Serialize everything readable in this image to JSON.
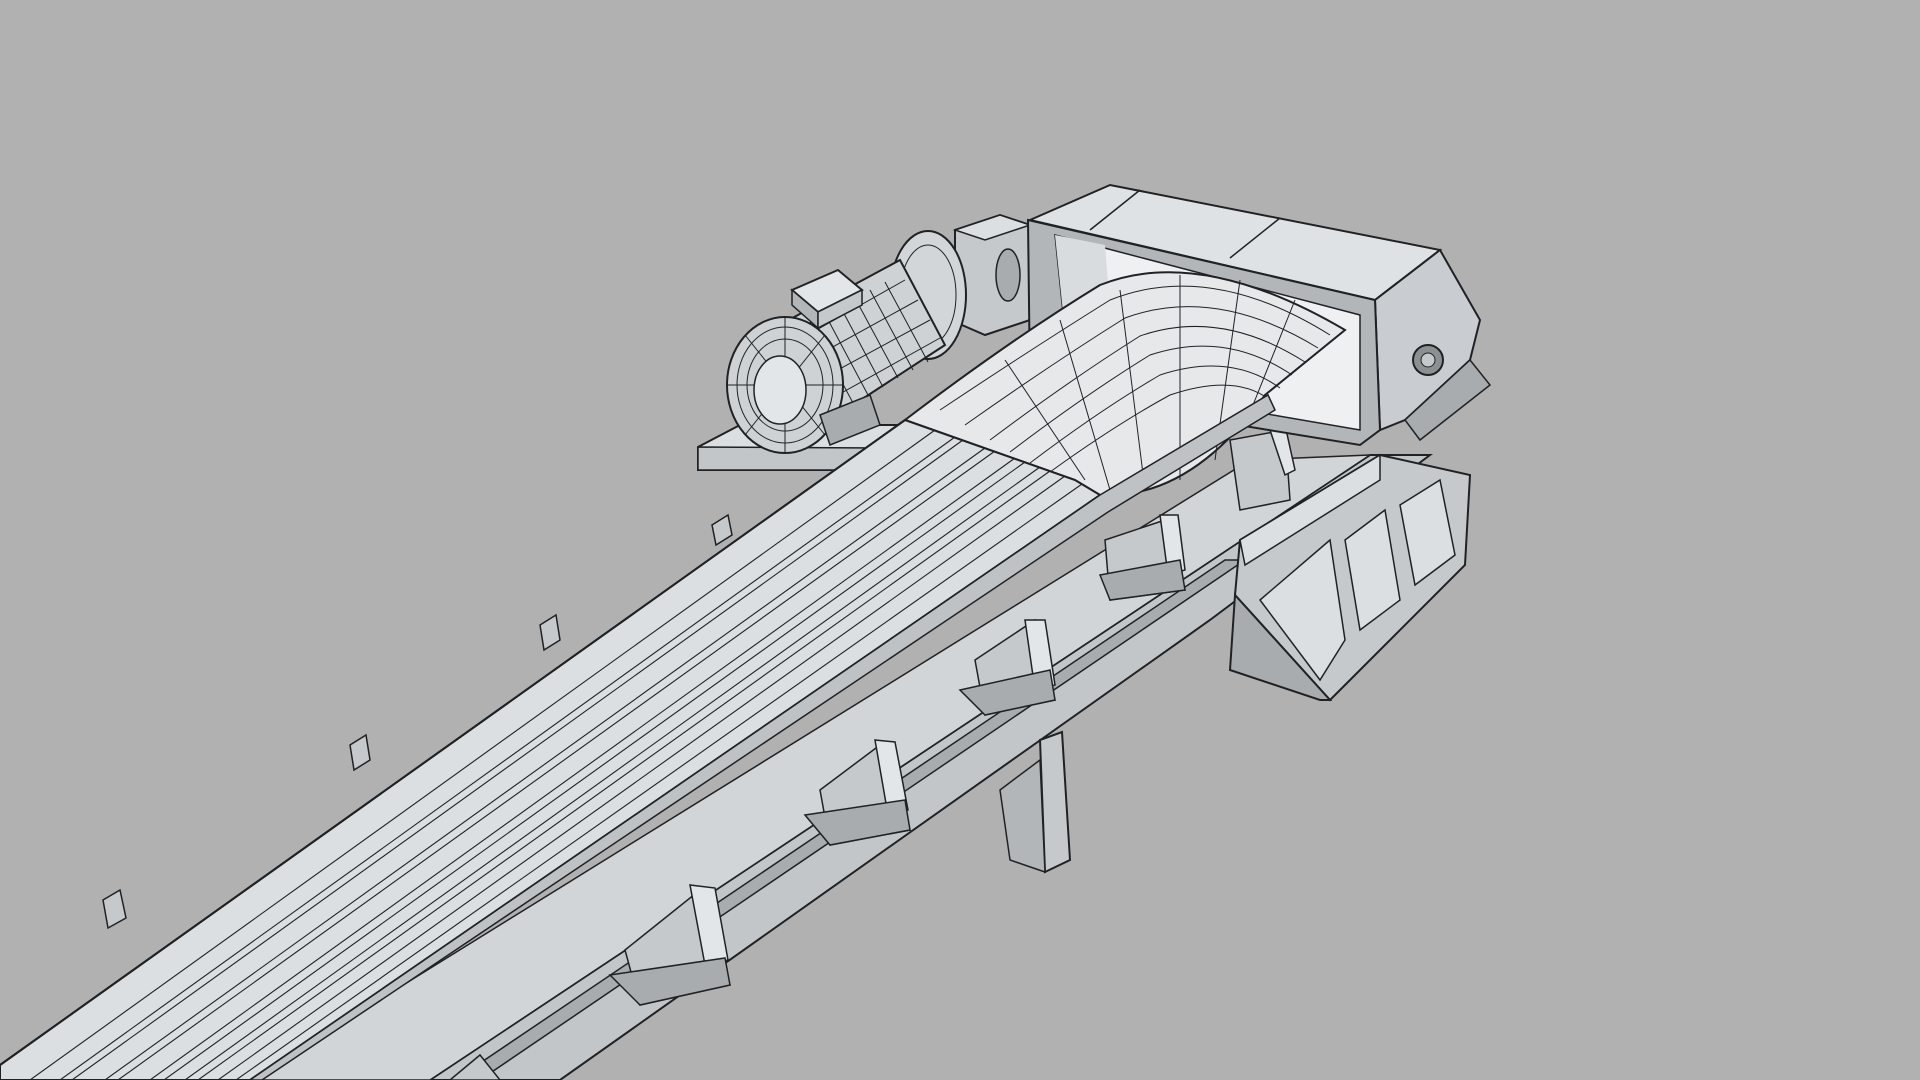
{
  "scene": {
    "subject": "belt-conveyor-with-drive-motor",
    "render_style": "grey-clay-wireframe",
    "colors": {
      "background": "#b1b1b1",
      "surface": "#dcdfe2",
      "surface_shade": "#c6c9cc",
      "surface_dark": "#a9acaf",
      "shadow": "#8d9093",
      "line": "#1f2225"
    },
    "components": [
      "conveyor-belt",
      "electric-motor",
      "gearbox",
      "motor-base-plate",
      "head-pulley-housing",
      "discharge-chute",
      "carrying-idlers",
      "return-idlers",
      "support-frame"
    ]
  }
}
